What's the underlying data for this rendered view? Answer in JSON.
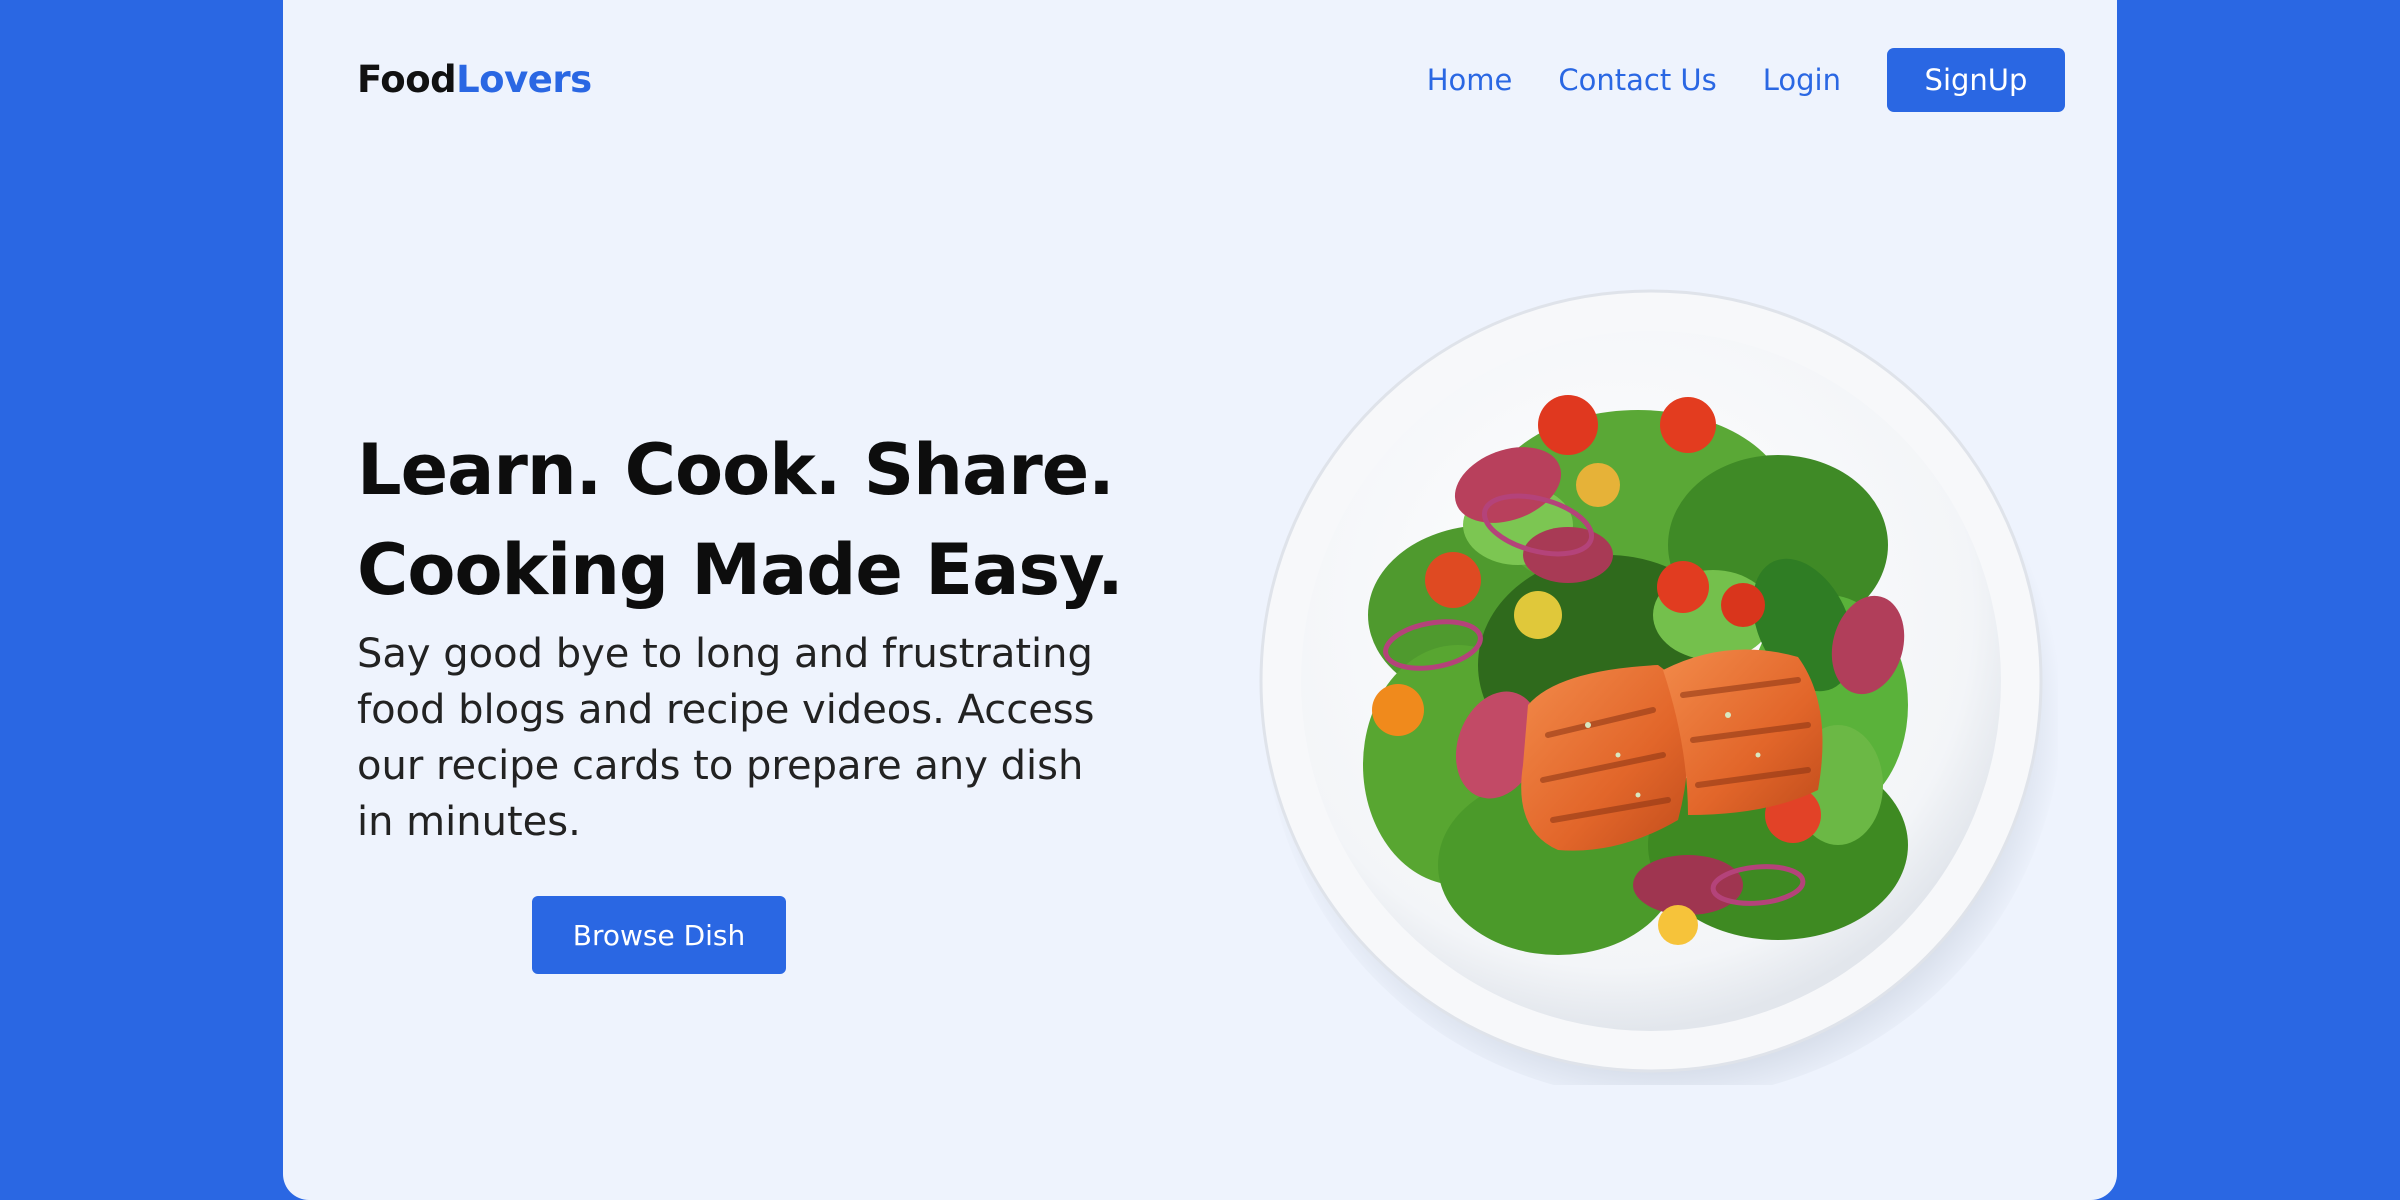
{
  "brand": {
    "logo_part1": "Food",
    "logo_part2": "Lovers"
  },
  "nav": {
    "home": "Home",
    "contact": "Contact Us",
    "login": "Login",
    "signup": "SignUp"
  },
  "hero": {
    "headline_line1": "Learn. Cook. Share.",
    "headline_line2": "Cooking Made Easy.",
    "description": "Say good bye to long and frustrating food blogs and recipe videos. Access our recipe cards to prepare any dish in minutes.",
    "cta_label": "Browse Dish",
    "image_subject": "salmon-salad-plate"
  },
  "colors": {
    "accent": "#2a67e3",
    "card_background": "#eef3fd",
    "heading_text": "#0d0d0d"
  }
}
